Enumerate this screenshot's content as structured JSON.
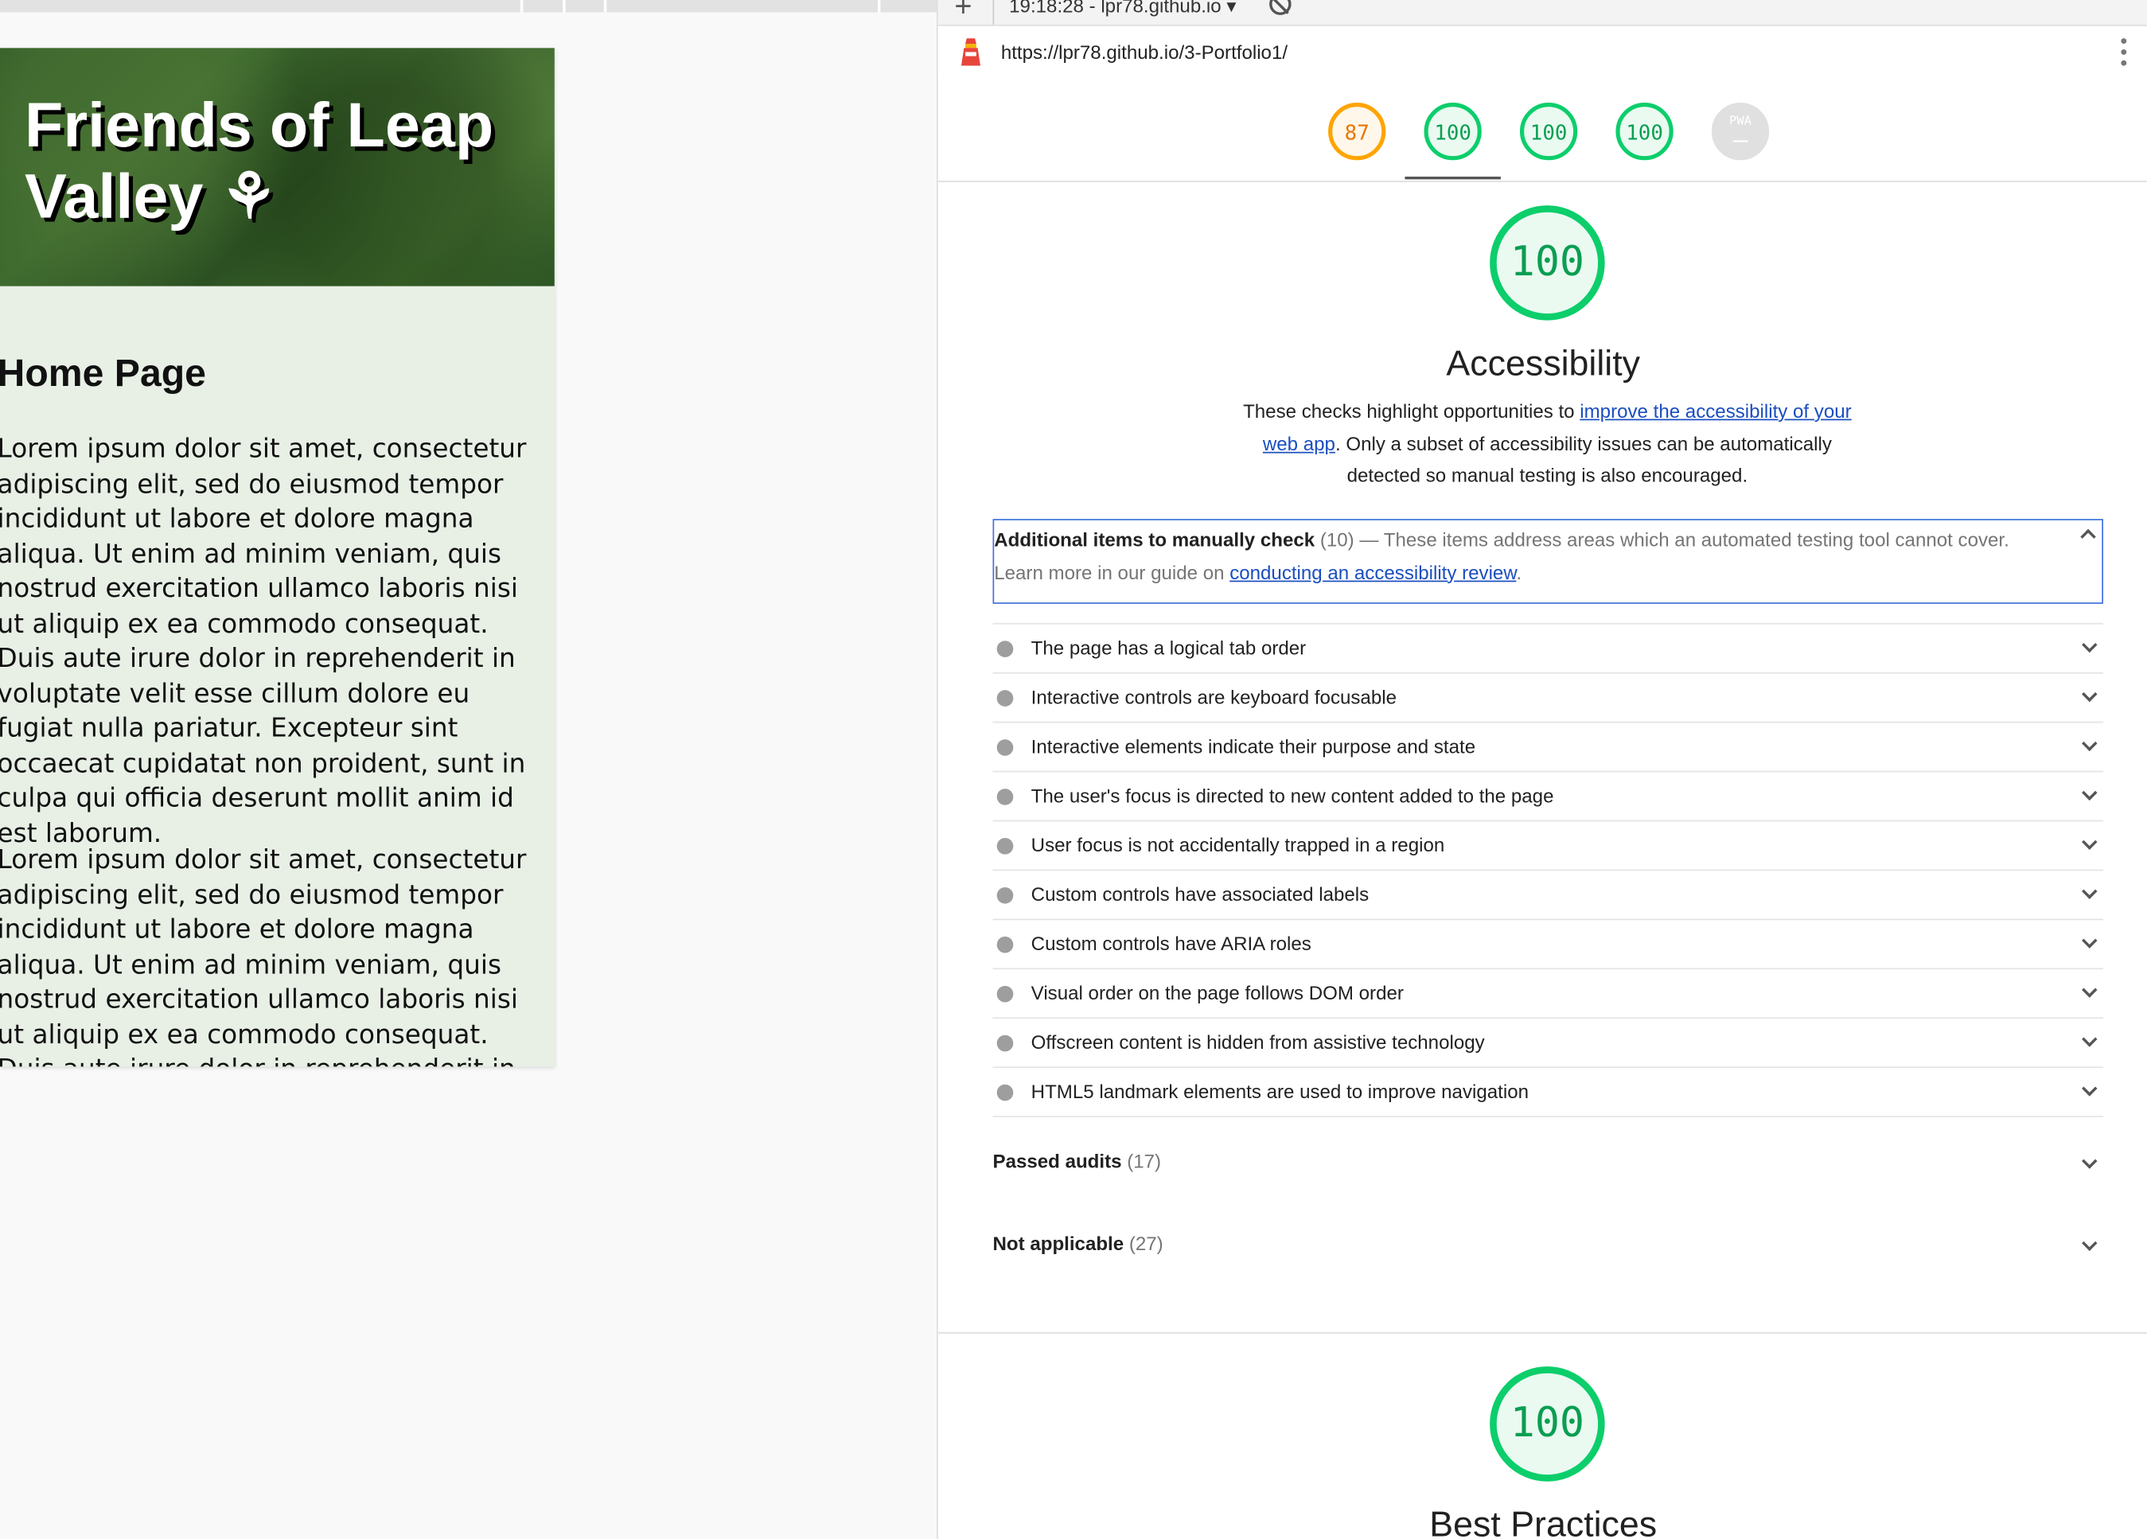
{
  "preview": {
    "site_title": "Friends of Leap Valley ⚘",
    "page_heading": "Home Page",
    "paragraphs": [
      "Lorem ipsum dolor sit amet, consectetur adipiscing elit, sed do eiusmod tempor incididunt ut labore et dolore magna aliqua. Ut enim ad minim veniam, quis nostrud exercitation ullamco laboris nisi ut aliquip ex ea commodo consequat. Duis aute irure dolor in reprehenderit in voluptate velit esse cillum dolore eu fugiat nulla pariatur. Excepteur sint occaecat cupidatat non proident, sunt in culpa qui officia deserunt mollit anim id est laborum.",
      "Lorem ipsum dolor sit amet, consectetur adipiscing elit, sed do eiusmod tempor incididunt ut labore et dolore magna aliqua. Ut enim ad minim veniam, quis nostrud exercitation ullamco laboris nisi ut aliquip ex ea commodo consequat. Duis aute irure dolor in reprehenderit in voluptate velit esse cillum dolore eu fugiat nulla pariatur. Excepteur sint"
    ]
  },
  "lighthouse": {
    "topbar": {
      "plus": "+",
      "report_stamp": "19:18:28 - lpr78.github.io ▾"
    },
    "url": "https://lpr78.github.io/3-Portfolio1/",
    "scores": [
      {
        "value": "87",
        "status": "average",
        "color": "#ffa400"
      },
      {
        "value": "100",
        "status": "pass",
        "color": "#0cce6b"
      },
      {
        "value": "100",
        "status": "pass",
        "color": "#0cce6b"
      },
      {
        "value": "100",
        "status": "pass",
        "color": "#0cce6b"
      },
      {
        "value": "PWA",
        "symbol": "—",
        "status": "na",
        "color": "#e0e0e0"
      }
    ],
    "accessibility": {
      "score": "100",
      "title": "Accessibility",
      "desc_before": "These checks highlight opportunities to ",
      "desc_link": "improve the accessibility of your web app",
      "desc_after": ". Only a subset of accessibility issues can be automatically detected so manual testing is also encouraged."
    },
    "manual": {
      "title": "Additional items to manually check",
      "count": "(10)",
      "dash": " — ",
      "desc": "These items address areas which an automated testing tool cannot cover. Learn more in our guide on ",
      "link": "conducting an accessibility review",
      "period": "."
    },
    "audits": [
      "The page has a logical tab order",
      "Interactive controls are keyboard focusable",
      "Interactive elements indicate their purpose and state",
      "The user's focus is directed to new content added to the page",
      "User focus is not accidentally trapped in a region",
      "Custom controls have associated labels",
      "Custom controls have ARIA roles",
      "Visual order on the page follows DOM order",
      "Offscreen content is hidden from assistive technology",
      "HTML5 landmark elements are used to improve navigation"
    ],
    "passed": {
      "label": "Passed audits",
      "count": "(17)"
    },
    "not_applicable": {
      "label": "Not applicable",
      "count": "(27)"
    },
    "best_practices": {
      "score": "100",
      "title": "Best Practices"
    }
  }
}
